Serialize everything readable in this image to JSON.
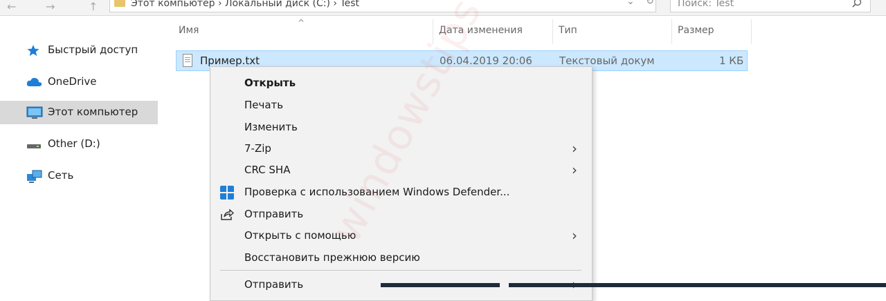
{
  "nav": {
    "back": "←",
    "forward": "→",
    "up": "↑"
  },
  "address": {
    "path": "Этот компьютер  ›  Локальный диск (C:)  ›  Test",
    "dropdown": "⌄",
    "refresh": "↻"
  },
  "search": {
    "placeholder": "Поиск: Test",
    "icon": "search-icon"
  },
  "sidebar": {
    "items": [
      {
        "label": "Быстрый доступ",
        "icon": "star-icon",
        "color": "#1e7fd8"
      },
      {
        "label": "OneDrive",
        "icon": "cloud-icon",
        "color": "#1e7fd8"
      },
      {
        "label": "Этот компьютер",
        "icon": "computer-icon",
        "color": "#2a8ad8",
        "selected": true
      },
      {
        "label": "Other (D:)",
        "icon": "drive-icon",
        "color": "#555555"
      },
      {
        "label": "Сеть",
        "icon": "network-icon",
        "color": "#2a8ad8"
      }
    ]
  },
  "columns": {
    "name": "Имя",
    "date": "Дата изменения",
    "type": "Тип",
    "size": "Размер"
  },
  "file": {
    "name": "Пример.txt",
    "date": "06.04.2019 20:06",
    "type": "Текстовый докум",
    "size": "1 КБ"
  },
  "context_menu": {
    "items": [
      {
        "label": "Открыть",
        "bold": true,
        "submenu": false
      },
      {
        "label": "Печать",
        "submenu": false
      },
      {
        "label": "Изменить",
        "submenu": false
      },
      {
        "label": "7-Zip",
        "submenu": true
      },
      {
        "label": "CRC SHA",
        "submenu": true
      },
      {
        "label": "Проверка с использованием Windows Defender...",
        "submenu": false,
        "icon": "windows-defender-icon"
      },
      {
        "label": "Отправить",
        "submenu": false,
        "icon": "share-icon"
      },
      {
        "label": "Открыть с помощью",
        "submenu": true
      },
      {
        "label": "Восстановить прежнюю версию",
        "submenu": false
      },
      {
        "label": "Отправить",
        "submenu": true
      }
    ],
    "submenu_arrow": "›"
  },
  "watermark": "windowstips",
  "colors": {
    "selection": "#cce8ff",
    "selection_border": "#99d1ff",
    "menu_bg": "#f2f2f2",
    "accent": "#1e7fd8"
  }
}
